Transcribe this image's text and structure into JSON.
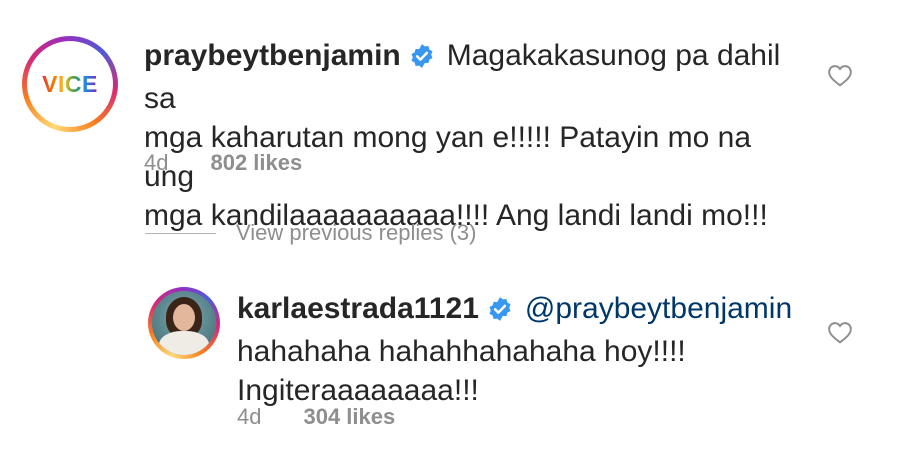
{
  "comments": [
    {
      "username": "praybeytbenjamin",
      "avatar_text": "VICE",
      "text_lines": [
        "Magakakasunog pa dahil sa",
        "mga kaharutan mong yan e!!!!! Patayin mo na ung",
        "mga kandilaaaaaaaaaa!!!! Ang landi landi mo!!!"
      ],
      "time": "4d",
      "likes": "802 likes"
    }
  ],
  "replies_toggle": {
    "label": "View previous replies (3)"
  },
  "replies": [
    {
      "username": "karlaestrada1121",
      "mention": "@praybeytbenjamin",
      "text_lines": [
        "hahahaha hahahhahahaha hoy!!!!",
        "Ingiteraaaaaaaa!!!"
      ],
      "time": "4d",
      "likes": "304 likes"
    }
  ],
  "icons": {
    "verified": "verified-badge-icon",
    "like": "heart-outline-icon"
  },
  "colors": {
    "verified": "#3897f0",
    "mention": "#00376b",
    "meta": "#8e8e8e",
    "text": "#262626"
  }
}
